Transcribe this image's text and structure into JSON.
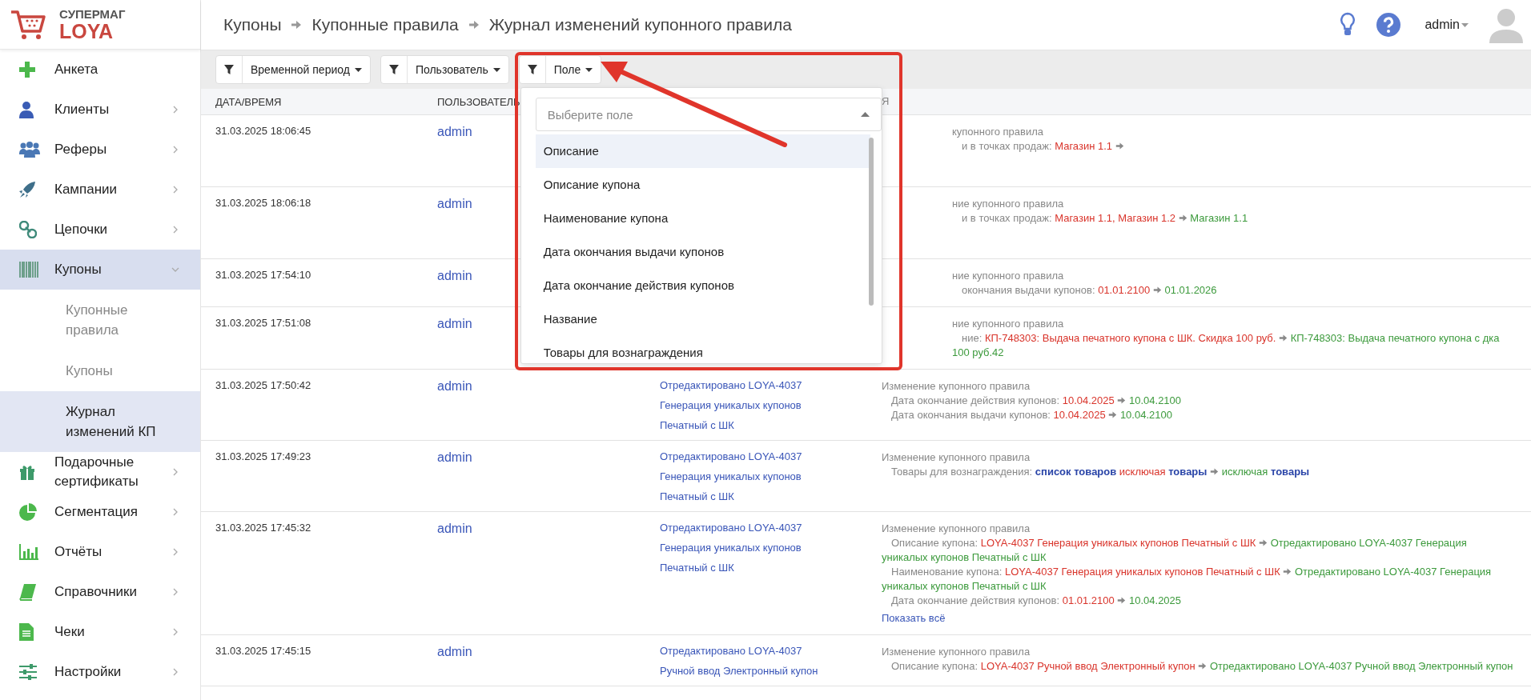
{
  "brand": {
    "top": "СУПЕРМАГ",
    "bottom": "LOYA"
  },
  "breadcrumb": [
    "Купоны",
    "Купонные правила",
    "Журнал изменений купонного правила"
  ],
  "header": {
    "user": "admin"
  },
  "sidebar": {
    "items": [
      {
        "label": "Анкета",
        "kind": "link",
        "selected": false
      },
      {
        "label": "Клиенты",
        "kind": "group",
        "expanded": false,
        "selected": false
      },
      {
        "label": "Реферы",
        "kind": "group",
        "expanded": false,
        "selected": false
      },
      {
        "label": "Кампании",
        "kind": "group",
        "expanded": false,
        "selected": false
      },
      {
        "label": "Цепочки",
        "kind": "group",
        "expanded": false,
        "selected": false
      },
      {
        "label": "Купоны",
        "kind": "group",
        "expanded": true,
        "selected": true,
        "children": [
          {
            "label": "Купонные правила",
            "selected": false
          },
          {
            "label": "Купоны",
            "selected": false
          },
          {
            "label": "Журнал изменений КП",
            "selected": true
          }
        ]
      },
      {
        "label": "Подарочные сертификаты",
        "kind": "group",
        "expanded": false,
        "selected": false
      },
      {
        "label": "Сегментация",
        "kind": "group",
        "expanded": false,
        "selected": false
      },
      {
        "label": "Отчёты",
        "kind": "group",
        "expanded": false,
        "selected": false
      },
      {
        "label": "Справочники",
        "kind": "group",
        "expanded": false,
        "selected": false
      },
      {
        "label": "Чеки",
        "kind": "group",
        "expanded": false,
        "selected": false
      },
      {
        "label": "Настройки",
        "kind": "group",
        "expanded": false,
        "selected": false
      }
    ]
  },
  "filters": [
    {
      "label": "Временной период",
      "open": false
    },
    {
      "label": "Пользователь",
      "open": false
    },
    {
      "label": "Поле",
      "open": true
    }
  ],
  "field_dropdown": {
    "placeholder": "Выберите поле",
    "options": [
      {
        "label": "Описание",
        "selected": true
      },
      {
        "label": "Описание купона",
        "selected": false
      },
      {
        "label": "Наименование купона",
        "selected": false
      },
      {
        "label": "Дата окончания выдачи купонов",
        "selected": false
      },
      {
        "label": "Дата окончание действия купонов",
        "selected": false
      },
      {
        "label": "Название",
        "selected": false
      },
      {
        "label": "Товары для вознаграждения",
        "selected": false
      }
    ]
  },
  "table": {
    "columns": [
      "ДАТА/ВРЕМЯ",
      "ПОЛЬЗОВАТЕЛЬ",
      "Я"
    ],
    "rows": [
      {
        "datetime": "31.03.2025 18:06:45",
        "user": "admin",
        "title": "купонного правила",
        "changes": [
          {
            "label": "и в точках продаж:",
            "old": "Магазин 1.1"
          }
        ]
      },
      {
        "datetime": "31.03.2025 18:06:18",
        "user": "admin",
        "title": "ние купонного правила",
        "changes": [
          {
            "label": "и в точках продаж:",
            "old": "Магазин 1.1, Магазин 1.2",
            "new": "Магазин 1.1"
          }
        ]
      },
      {
        "datetime": "31.03.2025 17:54:10",
        "user": "admin",
        "title": "ние купонного правила",
        "changes": [
          {
            "label": "окончания выдачи купонов:",
            "old": "01.01.2100",
            "new": "01.01.2026"
          }
        ]
      },
      {
        "datetime": "31.03.2025 17:51:08",
        "user": "admin",
        "title": "ние купонного правила",
        "changes": [
          {
            "label": "ние:",
            "old": "КП-748303: Выдача печатного купона с ШК. Скидка 100 руб.",
            "new": "КП-748303: Выдача печатного купона с дка 100 руб.42"
          }
        ]
      },
      {
        "datetime": "31.03.2025 17:50:42",
        "user": "admin",
        "comment": [
          "Отредактировано LOYA-4037",
          "Генерация уникалых купонов",
          "Печатный с ШК"
        ],
        "title": "Изменение купонного правила",
        "changes": [
          {
            "label": "Дата окончание действия купонов:",
            "old": "10.04.2025",
            "new": "10.04.2100"
          },
          {
            "label": "Дата окончания выдачи купонов:",
            "old": "10.04.2025",
            "new": "10.04.2100"
          }
        ]
      },
      {
        "datetime": "31.03.2025 17:49:23",
        "user": "admin",
        "comment": [
          "Отредактировано LOYA-4037",
          "Генерация уникалых купонов",
          "Печатный с ШК"
        ],
        "title": "Изменение купонного правила",
        "changes": [
          {
            "label": "Товары для вознаграждения:",
            "old": "**список товаров** исключая **товары**",
            "new": "исключая **товары**"
          }
        ]
      },
      {
        "datetime": "31.03.2025 17:45:32",
        "user": "admin",
        "comment": [
          "Отредактировано LOYA-4037",
          "Генерация уникалых купонов",
          "Печатный с ШК"
        ],
        "title": "Изменение купонного правила",
        "changes": [
          {
            "label": "Описание купона:",
            "old": "LOYA-4037 Генерация уникалых купонов Печатный с ШК",
            "new": "Отредактировано LOYA-4037 Генерация уникалых купонов Печатный с ШК"
          },
          {
            "label": "Наименование купона:",
            "old": "LOYA-4037 Генерация уникалых купонов Печатный с ШК",
            "new": "Отредактировано LOYA-4037 Генерация уникалых купонов Печатный с ШК"
          },
          {
            "label": "Дата окончание действия купонов:",
            "old": "01.01.2100",
            "new": "10.04.2025"
          }
        ],
        "show_all": "Показать всё"
      },
      {
        "datetime": "31.03.2025 17:45:15",
        "user": "admin",
        "comment": [
          "Отредактировано LOYA-4037",
          "Ручной ввод Электронный купон"
        ],
        "title": "Изменение купонного правила",
        "changes": [
          {
            "label": "Описание купона:",
            "old": "LOYA-4037 Ручной ввод Электронный купон",
            "new": "Отредактировано LOYA-4037 Ручной ввод Электронный купон"
          }
        ]
      }
    ]
  }
}
